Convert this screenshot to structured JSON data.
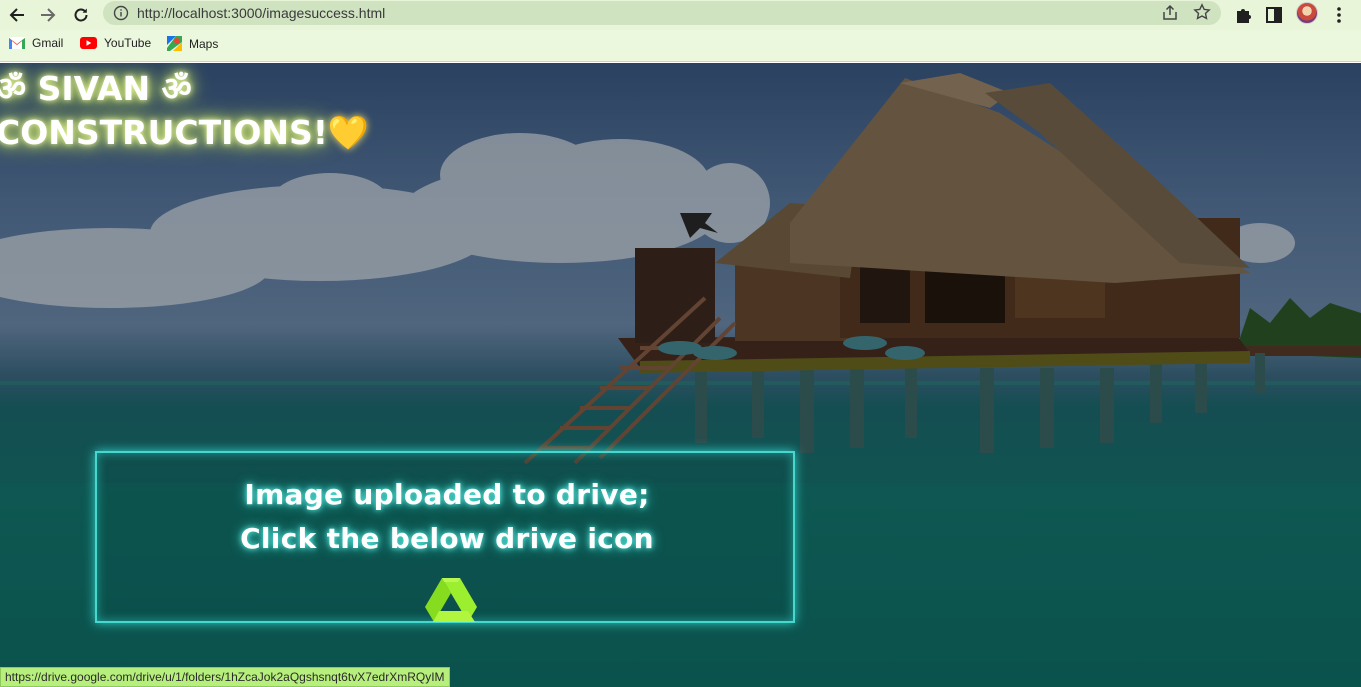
{
  "browser": {
    "url": "http://localhost:3000/imagesuccess.html",
    "bookmarks": [
      {
        "label": "Gmail",
        "icon": "gmail-icon"
      },
      {
        "label": "YouTube",
        "icon": "youtube-icon"
      },
      {
        "label": "Maps",
        "icon": "maps-icon"
      }
    ],
    "status_url": "https://drive.google.com/drive/u/1/folders/1hZcaJok2aQgshsnqt6tvX7edrXmRQyIM"
  },
  "page": {
    "brand_line1": "ॐ SIVAN ॐ",
    "brand_line2": "CONSTRUCTIONS!",
    "brand_heart": "💛",
    "message_line1": "Image uploaded to drive;",
    "message_line2": "Click the below drive icon",
    "drive_icon": "google-drive-icon"
  },
  "colors": {
    "toolbar_bg": "#e8f5d9",
    "glow_text": "#e9f7a0",
    "box_border": "#46d7cf",
    "drive_green": "#9cef2e",
    "status_bg": "#b7ef7c"
  }
}
